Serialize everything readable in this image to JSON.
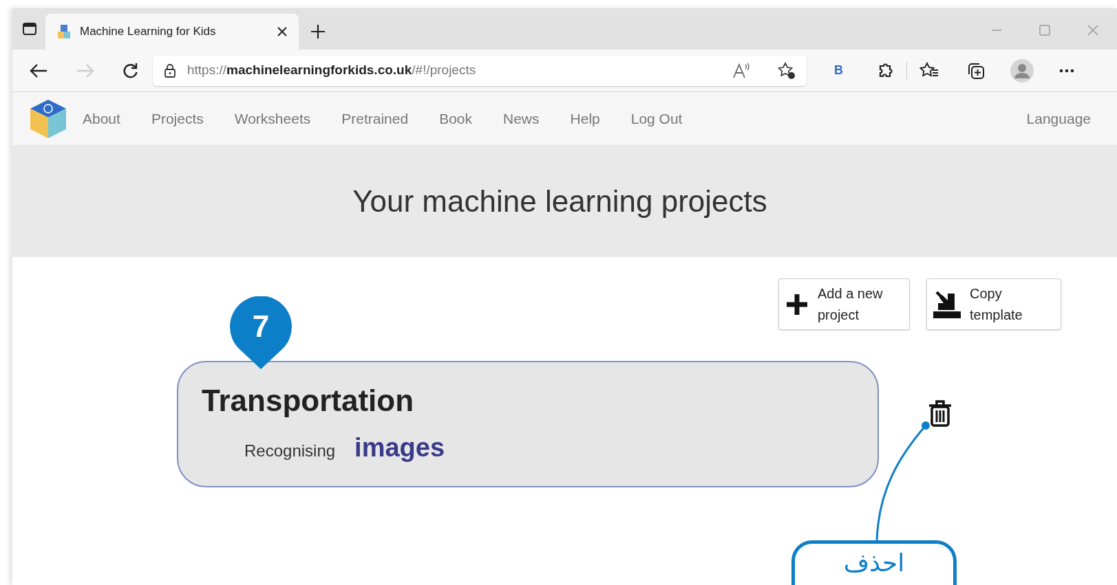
{
  "browser": {
    "tab_title": "Machine Learning for Kids",
    "url_prefix": "https://",
    "url_host": "machinelearningforkids.co.uk",
    "url_path": "/#!/projects",
    "extension_label": "B"
  },
  "nav": {
    "items": [
      {
        "label": "About"
      },
      {
        "label": "Projects"
      },
      {
        "label": "Worksheets"
      },
      {
        "label": "Pretrained"
      },
      {
        "label": "Book"
      },
      {
        "label": "News"
      },
      {
        "label": "Help"
      },
      {
        "label": "Log Out"
      }
    ],
    "language": "Language"
  },
  "heading": "Your machine learning projects",
  "actions": [
    {
      "kind": "add",
      "label": "Add a new project"
    },
    {
      "kind": "copy",
      "label": "Copy template"
    }
  ],
  "projects": [
    {
      "title": "Transportation",
      "type_prefix": "Recognising",
      "type": "images"
    }
  ],
  "annotations": [
    {
      "kind": "step",
      "text": "7"
    },
    {
      "kind": "callout",
      "text": "احذف"
    }
  ]
}
